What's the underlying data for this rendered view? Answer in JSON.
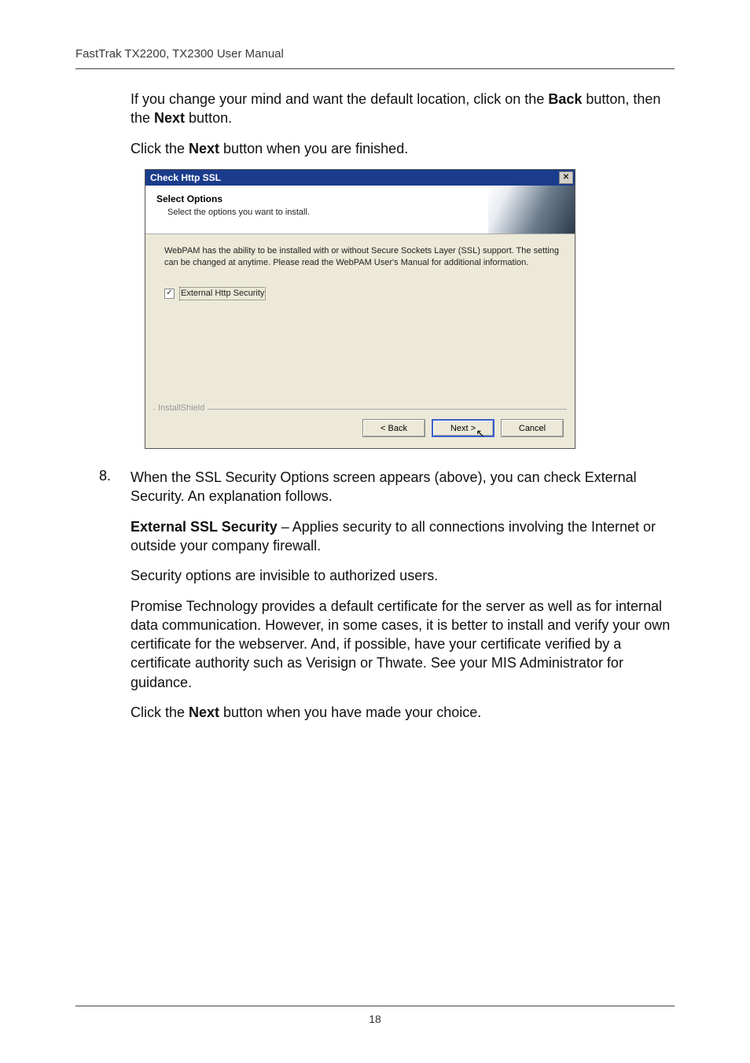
{
  "header": "FastTrak TX2200, TX2300 User Manual",
  "intro1_pre": "If you change your mind and want the default location, click on the ",
  "intro1_bold": "Back",
  "intro1_post": " button, then the ",
  "intro1_bold2": "Next",
  "intro1_end": " button.",
  "intro2_pre": "Click the ",
  "intro2_bold": "Next",
  "intro2_post": " button when you are finished.",
  "dialog": {
    "title": "Check Http SSL",
    "panel_title": "Select Options",
    "panel_sub": "Select the options you want to install.",
    "body": "WebPAM has the ability to be installed with or without Secure Sockets Layer (SSL) support. The setting can be changed at anytime. Please read the WebPAM User's Manual for additional information.",
    "checkbox": "External Http Security",
    "checkmark": "✓",
    "fieldset": "InstallShield",
    "back": "< Back",
    "next": "Next >",
    "cancel": "Cancel",
    "close_x": "✕"
  },
  "cursor_glyph": "↖",
  "step_num": "8.",
  "step8a": "When the SSL Security Options screen appears (above), you can check External Security. An explanation follows.",
  "step8b_bold": "External SSL Security",
  "step8b_rest": " – Applies security to all connections involving the Internet or outside your company firewall.",
  "step8c": "Security options are invisible to authorized users.",
  "step8d": "Promise Technology provides a default certificate for the server as well as for internal data communication. However, in some cases, it is better to install and verify your own certificate for the webserver. And, if possible, have your certificate verified by a certificate authority such as Verisign or Thwate. See your MIS Administrator for guidance.",
  "step8e_pre": "Click the ",
  "step8e_bold": "Next",
  "step8e_post": " button when you have made your choice.",
  "page_num": "18"
}
